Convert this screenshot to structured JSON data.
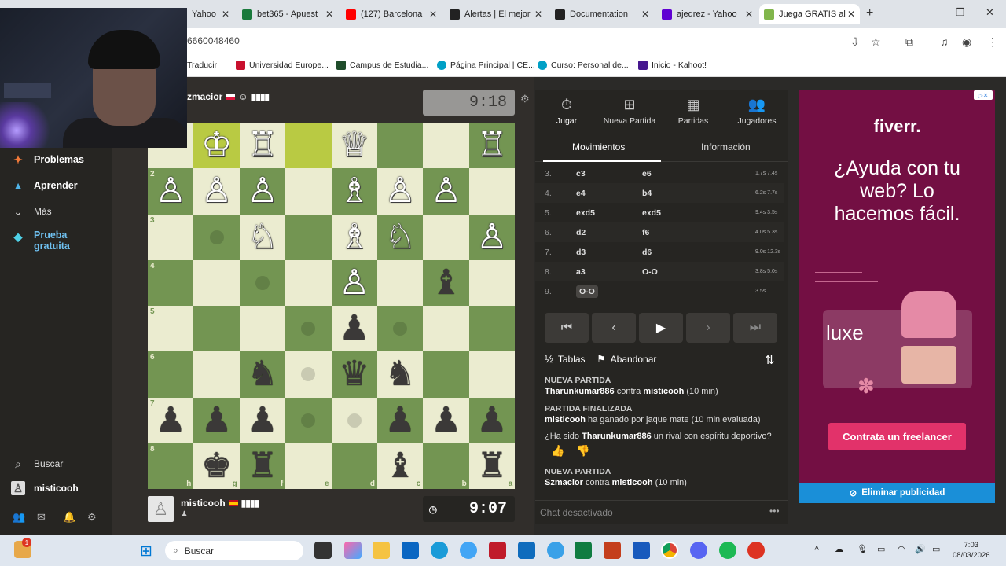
{
  "browser": {
    "tabs": [
      {
        "title": "Yahoo",
        "color": "#6001d2"
      },
      {
        "title": "bet365 - Apuest",
        "color": "#1a7a3c"
      },
      {
        "title": "(127) Barcelona",
        "color": "#ff0000"
      },
      {
        "title": "Alertas | El mejor",
        "color": "#222222"
      },
      {
        "title": "Documentation",
        "color": "#222222"
      },
      {
        "title": "ajedrez - Yahoo",
        "color": "#6001d2"
      },
      {
        "title": "Juega GRATIS al",
        "color": "#81b64c"
      }
    ],
    "url": "6660048460",
    "bookmarks": [
      "Traducir",
      "Universidad Europe...",
      "Campus de Estudia...",
      "Página Principal | CE...",
      "Curso: Personal de...",
      "Inicio - Kahoot!"
    ]
  },
  "sidebar": {
    "items": [
      {
        "label": "Problemas",
        "icon": "puzzle-icon"
      },
      {
        "label": "Aprender",
        "icon": "graduation-icon"
      },
      {
        "label": "Más",
        "icon": "chevron-down-icon"
      },
      {
        "label": "Prueba gratuita",
        "icon": "diamond-icon"
      }
    ],
    "search": "Buscar",
    "user": "misticooh"
  },
  "game": {
    "top_player": "zmacior",
    "top_clock": "9:18",
    "bottom_player": "misticooh",
    "bottom_clock": "9:07",
    "ranks_left": [
      "1",
      "2",
      "3",
      "4",
      "5",
      "6",
      "7",
      "8"
    ],
    "files_bottom": [
      "h",
      "g",
      "f",
      "e",
      "d",
      "c",
      "b",
      "a"
    ]
  },
  "panel": {
    "tabs": [
      "Jugar",
      "Nueva Partida",
      "Partidas",
      "Jugadores"
    ],
    "subtabs": [
      "Movimientos",
      "Información"
    ],
    "moves": [
      {
        "num": "3.",
        "white": "c3",
        "black": "e6",
        "times": "1.7s 7.4s"
      },
      {
        "num": "4.",
        "white": "e4",
        "black": "b4",
        "times": "6.2s 7.7s"
      },
      {
        "num": "5.",
        "white": "exd5",
        "black": "exd5",
        "times": "9.4s 3.5s"
      },
      {
        "num": "6.",
        "white": "d2",
        "black": "f6",
        "times": "4.0s 5.3s"
      },
      {
        "num": "7.",
        "white": "d3",
        "black": "d6",
        "times": "9.0s 12.3s"
      },
      {
        "num": "8.",
        "white": "a3",
        "black": "O-O",
        "times": "3.8s 5.0s"
      },
      {
        "num": "9.",
        "white": "O-O",
        "black": "",
        "times": "3.5s"
      }
    ],
    "draw_label": "Tablas",
    "resign_label": "Abandonar",
    "log": {
      "h1": "NUEVA PARTIDA",
      "l1_a": "Tharunkumar886",
      "l1_b": " contra ",
      "l1_c": "misticooh",
      "l1_d": " (10 min)",
      "h2": "PARTIDA FINALIZADA",
      "l2_a": "misticooh",
      "l2_b": " ha ganado por jaque mate (10 min evaluada)",
      "l3": "¿Ha sido ",
      "l3_b": "Tharunkumar886",
      "l3_c": " un rival con espíritu deportivo?",
      "h3": "NUEVA PARTIDA",
      "l4_a": "Szmacior",
      "l4_b": " contra ",
      "l4_c": "misticooh",
      "l4_d": " (10 min)"
    },
    "chat": "Chat desactivado"
  },
  "ad": {
    "logo": "fiverr.",
    "headline": "¿Ayuda con tu web? Lo hacemos fácil.",
    "brand": "luxe",
    "button": "Contrata un freelancer",
    "remove": "Eliminar publicidad"
  },
  "taskbar": {
    "search": "Buscar",
    "time": "7:03",
    "date": "08/03/2026",
    "notify_count": "1"
  },
  "colors": {
    "light_square": "#ebecd0",
    "dark_square": "#739552",
    "highlight": "#b9ca43",
    "ad_bg": "#730f43"
  }
}
